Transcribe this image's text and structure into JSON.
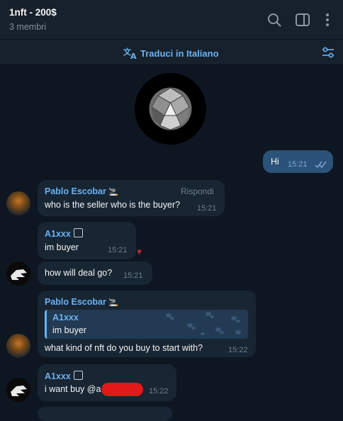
{
  "header": {
    "title": "1nft - 200$",
    "subtitle": "3 membri"
  },
  "translate_bar": {
    "label": "Traduci in Italiano"
  },
  "messages": [
    {
      "text": "Hi",
      "time": "15:21",
      "outgoing": true
    },
    {
      "sender": "Pablo Escobar",
      "sender_emoji": "🚬",
      "text": "who is the seller who is the buyer?",
      "time": "15:21",
      "action": "Rispondi"
    },
    {
      "sender": "A1xxx",
      "text": "im buyer",
      "time": "15:21",
      "reaction": "♥"
    },
    {
      "text": "how will deal go?",
      "time": "15:21"
    },
    {
      "sender": "Pablo Escobar",
      "sender_emoji": "🚬",
      "quote": {
        "sender": "A1xxx",
        "text": "im buyer"
      },
      "text": "what kind of nft do you buy to start with?",
      "time": "15:22"
    },
    {
      "sender": "A1xxx",
      "text": "i want buy @a",
      "time": "15:22"
    }
  ],
  "colors": {
    "background": "#0e1621",
    "header": "#17212b",
    "incoming_bubble": "#182533",
    "outgoing_bubble": "#2b5278",
    "accent": "#6ab2f2",
    "redaction": "#e11919"
  }
}
